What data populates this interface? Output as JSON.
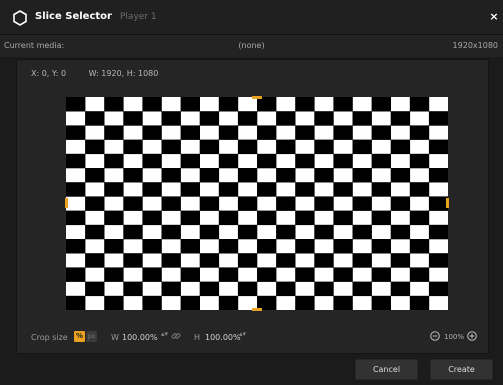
{
  "window": {
    "title": "Slice Selector",
    "subtitle": "Player 1",
    "close_label": "×"
  },
  "media": {
    "label": "Current media:",
    "value": "(none)",
    "resolution": "1920x1080"
  },
  "coords": {
    "position": "X: 0, Y: 0",
    "size": "W: 1920, H: 1080"
  },
  "preview": {
    "pattern": "checkerboard",
    "columns": 20,
    "rows": 15
  },
  "crop": {
    "label": "Crop size",
    "unit_percent_label": "%",
    "unit_pixel_label": "px",
    "w_label": "W",
    "w_value": "100.00%",
    "h_label": "H",
    "h_value": "100.00%",
    "spin_symbol": "▴▾"
  },
  "zoom": {
    "value": "100%"
  },
  "buttons": {
    "cancel": "Cancel",
    "create": "Create"
  },
  "colors": {
    "accent": "#e8a21f",
    "background": "#1b1b1b",
    "panel": "#252525"
  },
  "icons": {
    "app": "hexagon-icon",
    "link": "link-icon",
    "zoom_out": "zoom-out-icon",
    "zoom_in": "zoom-in-icon"
  }
}
